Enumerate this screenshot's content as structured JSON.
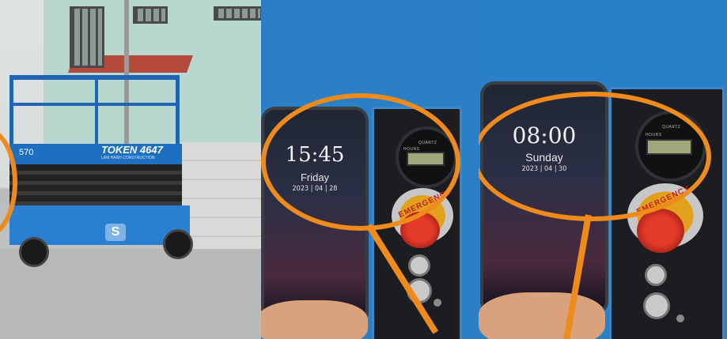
{
  "panel_left": {
    "lift_number": "570",
    "lift_brand": "TOKEN 4647",
    "lift_brand_sub": "LAM HANH CONSTRUCTION"
  },
  "panel_middle": {
    "phone_time": "15:45",
    "phone_day": "Friday",
    "phone_date": "2023 | 04 | 28",
    "meter_label_top": "QUARTZ",
    "meter_label_unit": "HOURS",
    "emergency_label": "EMERGENCY"
  },
  "panel_right": {
    "phone_time": "08:00",
    "phone_day": "Sunday",
    "phone_date": "2023 | 04 | 30",
    "meter_label_top": "QUARTZ",
    "meter_label_unit": "HOURS",
    "emergency_label": "EMERGENCY"
  },
  "colors": {
    "highlight": "#ef8a1d",
    "lift_blue": "#1f6fc0",
    "estop_red": "#e43a2a"
  }
}
